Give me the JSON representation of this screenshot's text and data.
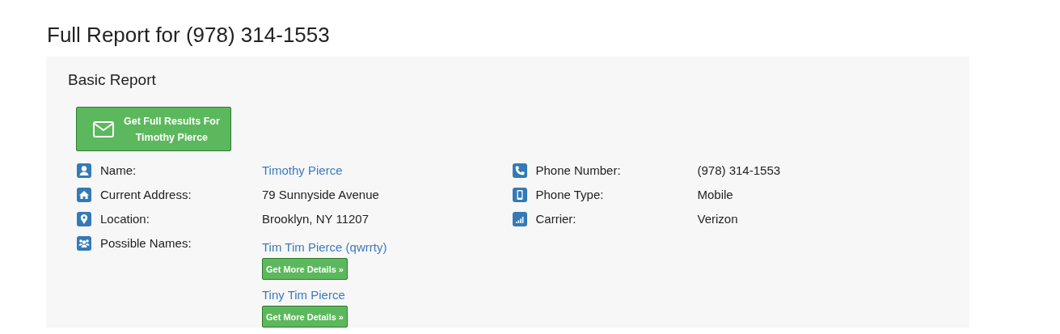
{
  "page_title": "Full Report for (978) 314-1553",
  "section_title": "Basic Report",
  "cta_button": {
    "line_1": "Get Full Results For",
    "line_2": "Timothy Pierce"
  },
  "left_fields": [
    {
      "label": "Name:",
      "value": "Timothy Pierce",
      "kind": "link"
    },
    {
      "label": "Current Address:",
      "value": "79 Sunnyside Avenue",
      "kind": "text"
    },
    {
      "label": "Location:",
      "value": "Brooklyn, NY 11207",
      "kind": "text"
    },
    {
      "label": "Possible Names:",
      "kind": "names",
      "names": [
        {
          "name": "Tim Tim Pierce (qwrrty)",
          "button": "Get More Details »"
        },
        {
          "name": "Tiny Tim Pierce",
          "button": "Get More Details »"
        }
      ]
    }
  ],
  "right_fields": [
    {
      "label": "Phone Number:",
      "value": "(978) 314-1553"
    },
    {
      "label": "Phone Type:",
      "value": "Mobile"
    },
    {
      "label": "Carrier:",
      "value": "Verizon"
    }
  ]
}
